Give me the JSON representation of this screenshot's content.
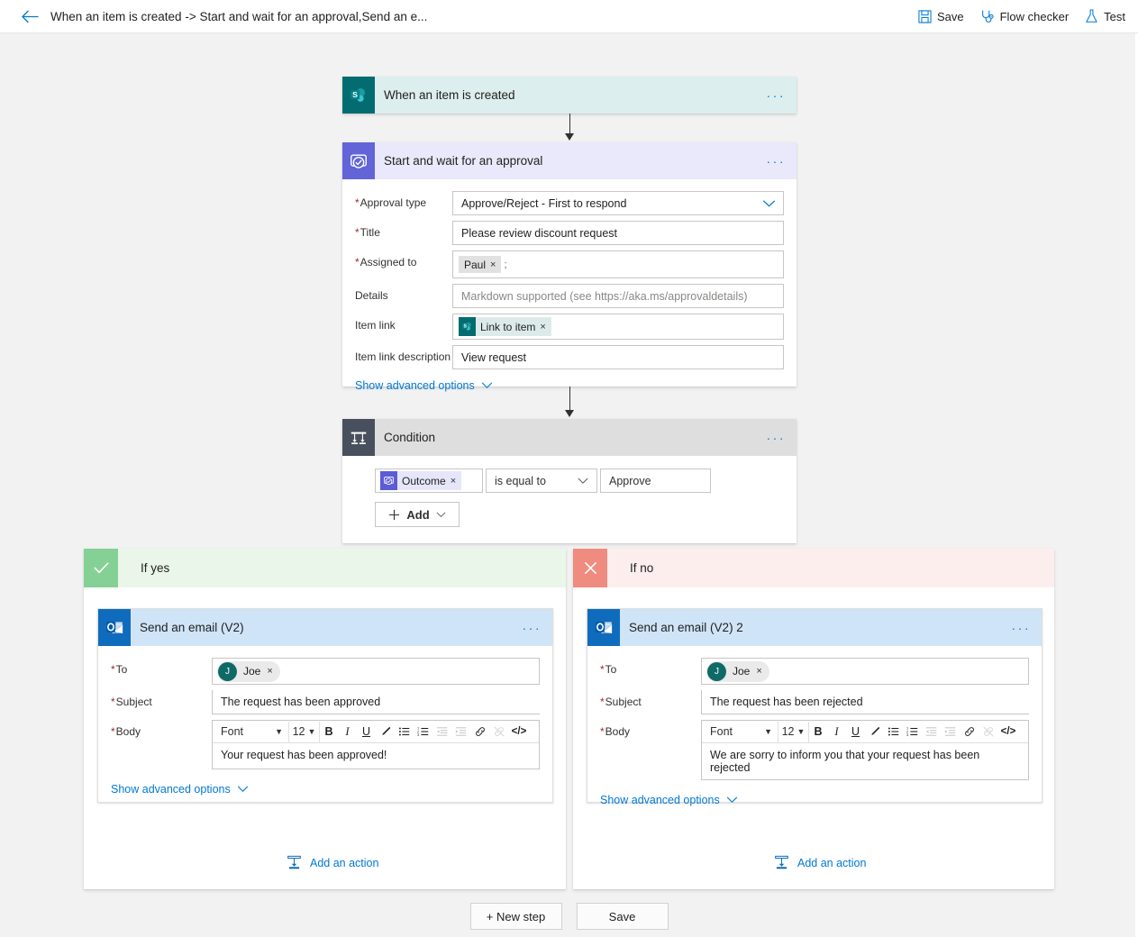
{
  "topbar": {
    "back_icon": "back-arrow-icon",
    "title": "When an item is created -> Start and wait for an approval,Send an e...",
    "actions": [
      {
        "label": "Save",
        "icon": "save-floppy-icon"
      },
      {
        "label": "Flow checker",
        "icon": "stethoscope-icon"
      },
      {
        "label": "Test",
        "icon": "flask-icon"
      }
    ]
  },
  "trigger": {
    "title": "When an item is created",
    "icon": "sharepoint-icon",
    "menu": "···"
  },
  "approval": {
    "title": "Start and wait for an approval",
    "icon": "approvals-icon",
    "menu": "···",
    "fields": {
      "approval_type": {
        "label": "Approval type",
        "required": true,
        "value": "Approve/Reject - First to respond",
        "icon": "chevron-down-icon"
      },
      "title": {
        "label": "Title",
        "required": true,
        "value": "Please review discount request"
      },
      "assigned_to": {
        "label": "Assigned to",
        "required": true,
        "chip": "Paul",
        "chip_remove": "×",
        "trailing": ";"
      },
      "details": {
        "label": "Details",
        "required": false,
        "placeholder": "Markdown supported (see https://aka.ms/approvaldetails)"
      },
      "item_link": {
        "label": "Item link",
        "required": false,
        "chip": "Link to item",
        "chip_remove": "×",
        "chip_icon": "sharepoint-icon"
      },
      "item_link_description": {
        "label": "Item link description",
        "required": false,
        "value": "View request"
      }
    },
    "advanced_options": "Show advanced options"
  },
  "condition": {
    "title": "Condition",
    "icon": "condition-branch-icon",
    "menu": "···",
    "row": {
      "left_token": "Outcome",
      "left_token_remove": "×",
      "left_token_icon": "approvals-icon",
      "operator": "is equal to",
      "operator_icon": "chevron-down-icon",
      "value": "Approve"
    },
    "add_button": {
      "label": "Add",
      "plus": "+",
      "icon": "chevron-down-icon"
    }
  },
  "branch_yes": {
    "label": "If yes",
    "tile_icon": "checkmark-icon",
    "action": {
      "title": "Send an email (V2)",
      "icon": "outlook-icon",
      "menu": "···",
      "fields": {
        "to": {
          "label": "To",
          "required": true,
          "chip": "Joe",
          "chip_initial": "J",
          "chip_remove": "×"
        },
        "subject": {
          "label": "Subject",
          "required": true,
          "value": "The request has been approved"
        },
        "body": {
          "label": "Body",
          "required": true,
          "value": "Your request has been approved!"
        }
      },
      "advanced_options": "Show advanced options"
    },
    "add_an_action": {
      "label": "Add an action",
      "icon": "add-action-icon"
    }
  },
  "branch_no": {
    "label": "If no",
    "tile_icon": "close-x-icon",
    "action": {
      "title": "Send an email (V2) 2",
      "icon": "outlook-icon",
      "menu": "···",
      "fields": {
        "to": {
          "label": "To",
          "required": true,
          "chip": "Joe",
          "chip_initial": "J",
          "chip_remove": "×"
        },
        "subject": {
          "label": "Subject",
          "required": true,
          "value": "The request has been rejected"
        },
        "body": {
          "label": "Body",
          "required": true,
          "value": "We are sorry to inform you that your request has been rejected"
        }
      },
      "advanced_options": "Show advanced options"
    },
    "add_an_action": {
      "label": "Add an action",
      "icon": "add-action-icon"
    }
  },
  "rte_toolbar": {
    "font_label": "Font",
    "font_caret": "▼",
    "size_label": "12",
    "size_caret": "▼",
    "bold": "B",
    "italic": "I",
    "underline": "U",
    "highlight_icon": "pen-highlight-icon",
    "bulleted_list_icon": "bulleted-list-icon",
    "numbered_list_icon": "numbered-list-icon",
    "outdent_icon": "decrease-indent-icon",
    "indent_icon": "increase-indent-icon",
    "link_icon": "link-icon",
    "unlink_icon": "unlink-icon",
    "code_icon": "code-icon",
    "code_label": "</>"
  },
  "bottom": {
    "new_step": "+ New step",
    "save": "Save"
  },
  "colors": {
    "sharepoint_teal": "#036c70",
    "approval_purple": "#5c5cd6",
    "condition_gray": "#48505e",
    "outlook_blue": "#0f6cbd",
    "yes_green": "#85d195",
    "no_red": "#f08b7f",
    "accent_blue": "#0078d4",
    "required_red": "#a4262c"
  }
}
